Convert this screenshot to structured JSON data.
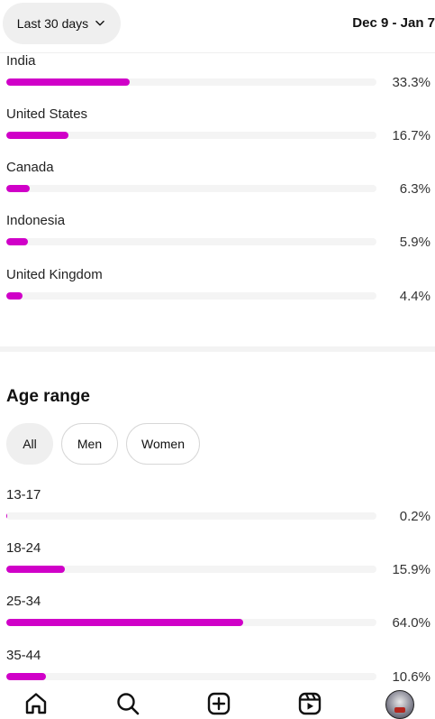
{
  "header": {
    "range_label": "Last 30 days",
    "date_range": "Dec 9 - Jan 7"
  },
  "locations": [
    {
      "name": "India",
      "percent_text": "33.3%",
      "value": 33.3
    },
    {
      "name": "United States",
      "percent_text": "16.7%",
      "value": 16.7
    },
    {
      "name": "Canada",
      "percent_text": "6.3%",
      "value": 6.3
    },
    {
      "name": "Indonesia",
      "percent_text": "5.9%",
      "value": 5.9
    },
    {
      "name": "United Kingdom",
      "percent_text": "4.4%",
      "value": 4.4
    }
  ],
  "age_section": {
    "title": "Age range",
    "filters": [
      {
        "label": "All",
        "active": true
      },
      {
        "label": "Men",
        "active": false
      },
      {
        "label": "Women",
        "active": false
      }
    ],
    "ranges": [
      {
        "name": "13-17",
        "percent_text": "0.2%",
        "value": 0.2
      },
      {
        "name": "18-24",
        "percent_text": "15.9%",
        "value": 15.9
      },
      {
        "name": "25-34",
        "percent_text": "64.0%",
        "value": 64.0
      },
      {
        "name": "35-44",
        "percent_text": "10.6%",
        "value": 10.6
      }
    ]
  },
  "colors": {
    "bar_fill": "#d000c8",
    "bar_track": "#f4f4f4",
    "chip_active": "#efefef"
  },
  "nav": {
    "items": [
      "home-icon",
      "search-icon",
      "create-icon",
      "reels-icon",
      "profile-avatar"
    ]
  }
}
